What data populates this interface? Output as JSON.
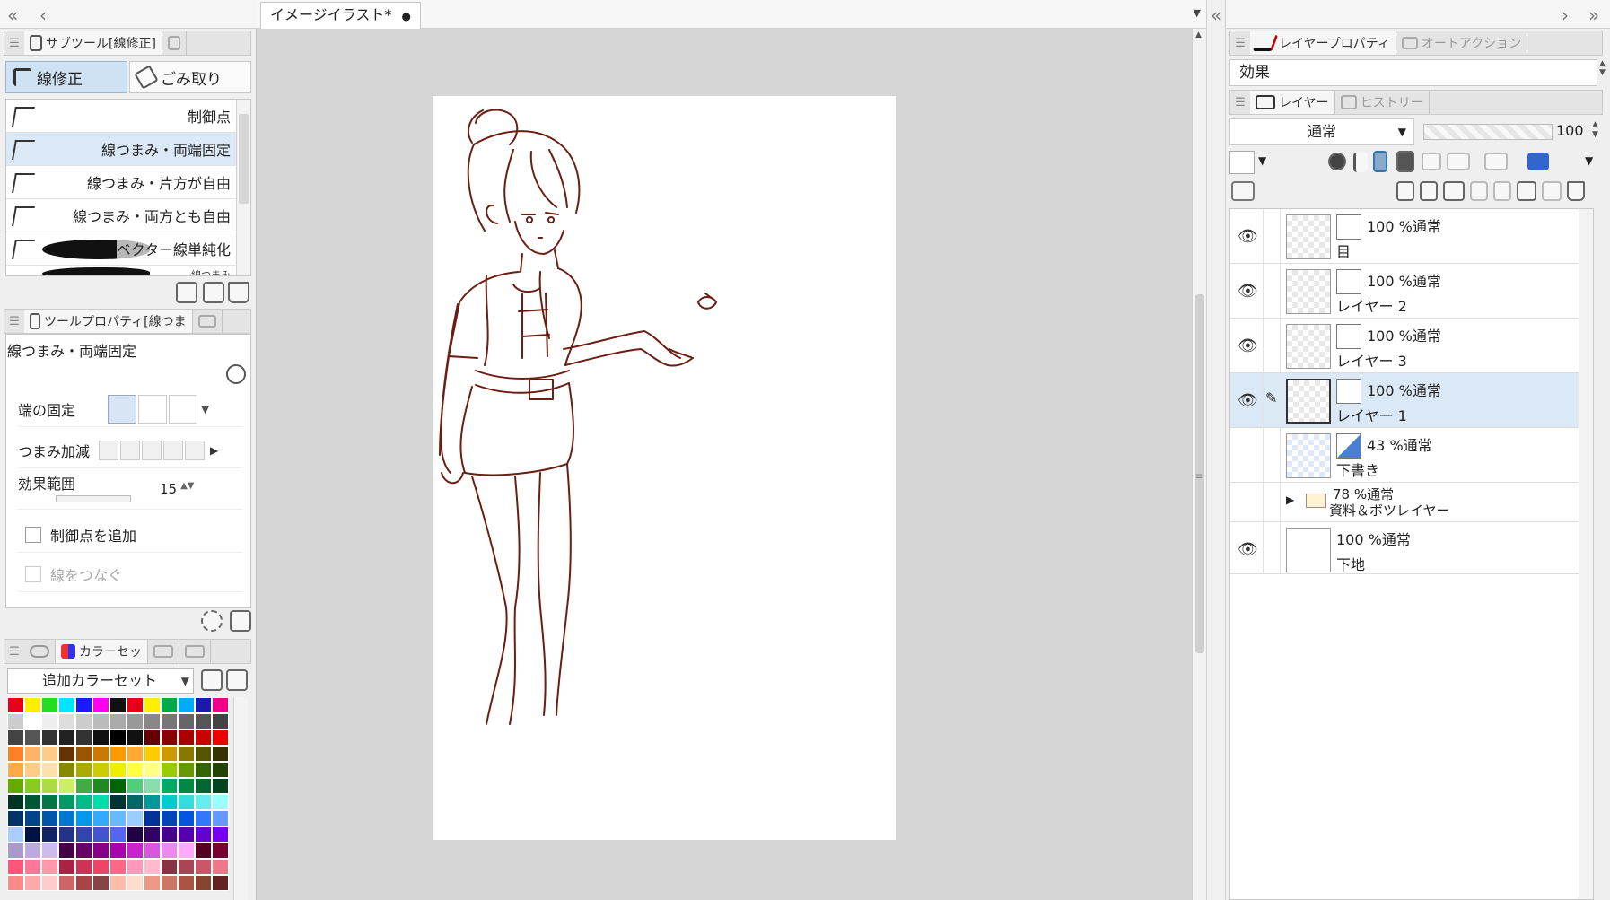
{
  "left_panel": {
    "subtool_header": "サブツール[線修正]",
    "subtool_tabs": [
      "線修正",
      "ごみ取り"
    ],
    "subtool_items": [
      "制御点",
      "線つまみ・両端固定",
      "線つまみ・片方が自由",
      "線つまみ・両方とも自由",
      "ベクター線単純化",
      "線つまみ"
    ],
    "tool_property_header": "ツールプロパティ[線つま",
    "tool_property_title": "線つまみ・両端固定",
    "fix_ends_label": "端の固定",
    "pinch_label": "つまみ加減",
    "effect_range_label": "効果範囲",
    "effect_range_value": "15",
    "add_control_point_label": "制御点を追加",
    "connect_lines_label": "線をつなぐ",
    "color_set_header": "カラーセッ",
    "color_set_select": "追加カラーセット",
    "swatch_colors": [
      "#e8001a",
      "#ffee00",
      "#22dd22",
      "#00e5ff",
      "#1a1aff",
      "#ff00ee",
      "#111111",
      "#e8001a",
      "#ffee00",
      "#00aa44",
      "#00aaff",
      "#1a1aaa",
      "#ee0088",
      "#cccccc",
      "#ffffff",
      "#eeeeee",
      "#dddddd",
      "#cccccc",
      "#bbbbbb",
      "#aaaaaa",
      "#999999",
      "#888888",
      "#777777",
      "#666666",
      "#555555",
      "#444444",
      "#444444",
      "#555555",
      "#333333",
      "#222222",
      "#333333",
      "#111111",
      "#000000",
      "#111111",
      "#660000",
      "#880000",
      "#aa0000",
      "#cc0000",
      "#ee0000",
      "#ff7f27",
      "#ffb366",
      "#ffcc88",
      "#663300",
      "#995500",
      "#cc7700",
      "#ff9900",
      "#ffaa33",
      "#ffcc00",
      "#cc9900",
      "#887700",
      "#555500",
      "#333300",
      "#ffaa44",
      "#ffcc88",
      "#ffe0aa",
      "#888800",
      "#aaaa00",
      "#cccc00",
      "#eeee00",
      "#ffff44",
      "#ffff88",
      "#99cc00",
      "#669900",
      "#336600",
      "#224400",
      "#66aa00",
      "#88cc22",
      "#aadd44",
      "#ccee66",
      "#44aa44",
      "#228822",
      "#006600",
      "#55cc77",
      "#88ddaa",
      "#00aa66",
      "#008844",
      "#006633",
      "#004422",
      "#003322",
      "#005533",
      "#007744",
      "#009966",
      "#00bb88",
      "#00ddaa",
      "#003333",
      "#006666",
      "#009999",
      "#00cccc",
      "#33dddd",
      "#66eeee",
      "#99ffff",
      "#003366",
      "#004488",
      "#0055aa",
      "#0077cc",
      "#0099ee",
      "#33aaff",
      "#66bbff",
      "#99ccff",
      "#003399",
      "#0044bb",
      "#0055dd",
      "#3377ff",
      "#6699ff",
      "#aaccff",
      "#001144",
      "#112266",
      "#223388",
      "#3344aa",
      "#4455cc",
      "#5566ee",
      "#220044",
      "#330066",
      "#440088",
      "#5500aa",
      "#6600cc",
      "#7700ee",
      "#aa99cc",
      "#bbaadd",
      "#ccbbee",
      "#440044",
      "#660066",
      "#880088",
      "#aa00aa",
      "#cc22cc",
      "#dd55dd",
      "#ee88ee",
      "#ffaaff",
      "#550022",
      "#770033",
      "#ff5577",
      "#ff7799",
      "#ff99aa",
      "#aa2244",
      "#cc3355",
      "#ee4466",
      "#ff6688",
      "#ff99bb",
      "#ffbbcc",
      "#883344",
      "#aa4455",
      "#cc5566",
      "#ee7788",
      "#ff8888",
      "#ffaaaa",
      "#ffcccc",
      "#cc6666",
      "#aa4444",
      "#884444",
      "#ffbbaa",
      "#ffddcc",
      "#ee9988",
      "#cc7766",
      "#aa5544",
      "#884433",
      "#662222"
    ]
  },
  "document": {
    "tab_title": "イメージイラスト*"
  },
  "right_panel": {
    "layer_property_tab": "レイヤープロパティ",
    "auto_action_tab": "オートアクション",
    "effect_label": "効果",
    "layer_tab": "レイヤー",
    "history_tab": "ヒストリー",
    "blend_mode": "通常",
    "opacity": "100",
    "layers": [
      {
        "mode": "100 %通常",
        "name": "目"
      },
      {
        "mode": "100 %通常",
        "name": "レイヤー 2"
      },
      {
        "mode": "100 %通常",
        "name": "レイヤー 3"
      },
      {
        "mode": "100 %通常",
        "name": "レイヤー 1"
      },
      {
        "mode": "43 %通常",
        "name": "下書き"
      },
      {
        "mode": "78 %通常",
        "name": "資料＆ボツレイヤー"
      },
      {
        "mode": "100 %通常",
        "name": "下地"
      }
    ]
  },
  "colors": {
    "selection": "#dbe9f7",
    "line_art": "#6b1e12"
  }
}
